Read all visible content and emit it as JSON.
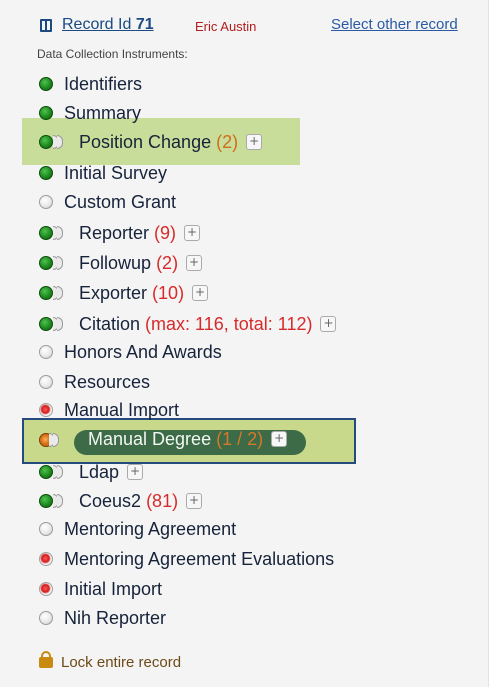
{
  "record": {
    "prefix": "Record Id",
    "id": "71",
    "name": "Eric Austin",
    "select_other": "Select other record"
  },
  "dci_label": "Data Collection Instruments:",
  "instruments": [
    {
      "label": "Identifiers",
      "status": "green",
      "stacked": false,
      "count": "",
      "plus": false
    },
    {
      "label": "Summary",
      "status": "green",
      "stacked": false,
      "count": "",
      "plus": false
    },
    {
      "label": "Position Change",
      "status": "green",
      "stacked": true,
      "count": "(2)",
      "plus": true
    },
    {
      "label": "Initial Survey",
      "status": "green",
      "stacked": false,
      "count": "",
      "plus": false
    },
    {
      "label": "Custom Grant",
      "status": "gray",
      "stacked": false,
      "count": "",
      "plus": false
    },
    {
      "label": "Reporter",
      "status": "green",
      "stacked": true,
      "count": "(9)",
      "plus": true
    },
    {
      "label": "Followup",
      "status": "green",
      "stacked": true,
      "count": "(2)",
      "plus": true
    },
    {
      "label": "Exporter",
      "status": "green",
      "stacked": true,
      "count": "(10)",
      "plus": true
    },
    {
      "label": "Citation",
      "status": "green",
      "stacked": true,
      "count": "(max: 116, total: 112)",
      "plus": true
    },
    {
      "label": "Honors And Awards",
      "status": "gray",
      "stacked": false,
      "count": "",
      "plus": false
    },
    {
      "label": "Resources",
      "status": "gray",
      "stacked": false,
      "count": "",
      "plus": false
    },
    {
      "label": "Manual Import",
      "status": "red",
      "stacked": false,
      "count": "",
      "plus": false
    },
    {
      "label": "Manual Degree",
      "status": "orange",
      "stacked": true,
      "count": "(1 / 2)",
      "plus": true
    },
    {
      "label": "Ldap",
      "status": "green",
      "stacked": true,
      "count": "",
      "plus": true
    },
    {
      "label": "Coeus2",
      "status": "green",
      "stacked": true,
      "count": "(81)",
      "plus": true
    },
    {
      "label": "Mentoring Agreement",
      "status": "gray",
      "stacked": false,
      "count": "",
      "plus": false
    },
    {
      "label": "Mentoring Agreement Evaluations",
      "status": "red",
      "stacked": false,
      "count": "",
      "plus": false
    },
    {
      "label": "Initial Import",
      "status": "red",
      "stacked": false,
      "count": "",
      "plus": false
    },
    {
      "label": "Nih Reporter",
      "status": "gray",
      "stacked": false,
      "count": "",
      "plus": false
    }
  ],
  "lock_label": "Lock entire record",
  "plus_glyph": "+",
  "colors": {
    "link": "#1a4a80",
    "record_name": "#b11d1d",
    "count_red": "#d82a2a",
    "highlight_green": "#bfd88a",
    "pill": "#3d6b47",
    "lock": "#c98a12"
  },
  "icons": {
    "record": "record-icon",
    "status": "status-circle-icon",
    "repeat": "repeat-stack-icon",
    "add": "plus-icon",
    "lock": "lock-icon"
  }
}
